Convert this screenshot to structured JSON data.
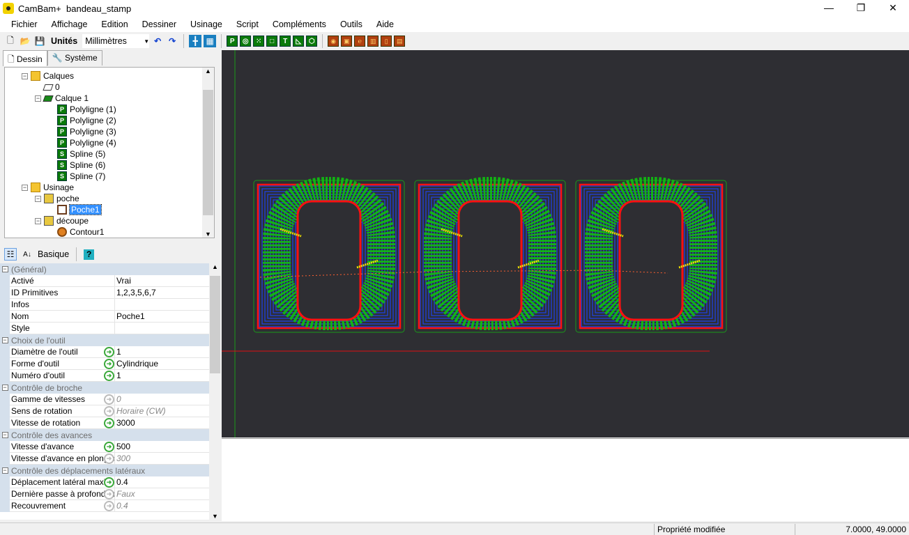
{
  "window": {
    "app": "CamBam+",
    "file": "bandeau_stamp",
    "minimize": "—",
    "maximize": "❐",
    "close": "✕"
  },
  "menu": [
    "Fichier",
    "Affichage",
    "Edition",
    "Dessiner",
    "Usinage",
    "Script",
    "Compléments",
    "Outils",
    "Aide"
  ],
  "toolbar": {
    "units_label": "Unités",
    "units_value": "Millimètres"
  },
  "tabs": [
    {
      "label": "Dessin",
      "icon": "page-icon"
    },
    {
      "label": "Système",
      "icon": "wrench-icon"
    }
  ],
  "tree": [
    {
      "label": "Calques",
      "depth": 0,
      "icon": "folder",
      "exp": "−"
    },
    {
      "label": "0",
      "depth": 1,
      "icon": "layer",
      "exp": ""
    },
    {
      "label": "Calque 1",
      "depth": 1,
      "icon": "layerg",
      "exp": "−"
    },
    {
      "label": "Polyligne (1)",
      "depth": 2,
      "icon": "poly",
      "exp": ""
    },
    {
      "label": "Polyligne (2)",
      "depth": 2,
      "icon": "poly",
      "exp": ""
    },
    {
      "label": "Polyligne (3)",
      "depth": 2,
      "icon": "poly",
      "exp": ""
    },
    {
      "label": "Polyligne (4)",
      "depth": 2,
      "icon": "poly",
      "exp": ""
    },
    {
      "label": "Spline (5)",
      "depth": 2,
      "icon": "spline",
      "exp": ""
    },
    {
      "label": "Spline (6)",
      "depth": 2,
      "icon": "spline",
      "exp": ""
    },
    {
      "label": "Spline (7)",
      "depth": 2,
      "icon": "spline",
      "exp": ""
    },
    {
      "label": "Usinage",
      "depth": 0,
      "icon": "folder",
      "exp": "−"
    },
    {
      "label": "poche",
      "depth": 1,
      "icon": "cube",
      "exp": "−"
    },
    {
      "label": "Poche1",
      "depth": 2,
      "icon": "pocket",
      "exp": "",
      "selected": true
    },
    {
      "label": "découpe",
      "depth": 1,
      "icon": "cube",
      "exp": "−"
    },
    {
      "label": "Contour1",
      "depth": 2,
      "icon": "contour",
      "exp": ""
    }
  ],
  "propbar": {
    "mode": "Basique",
    "help": "?"
  },
  "properties": [
    {
      "cat": "(Général)"
    },
    {
      "name": "Activé",
      "value": "Vrai"
    },
    {
      "name": "ID Primitives",
      "value": "1,2,3,5,6,7"
    },
    {
      "name": "Infos",
      "value": ""
    },
    {
      "name": "Nom",
      "value": "Poche1"
    },
    {
      "name": "Style",
      "value": ""
    },
    {
      "cat": "Choix de l'outil"
    },
    {
      "name": "Diamètre de l'outil",
      "value": "1",
      "arrow": "on"
    },
    {
      "name": "Forme d'outil",
      "value": "Cylindrique",
      "arrow": "on"
    },
    {
      "name": "Numéro d'outil",
      "value": "1",
      "arrow": "on"
    },
    {
      "cat": "Contrôle de broche"
    },
    {
      "name": "Gamme de vitesses",
      "value": "0",
      "arrow": "off"
    },
    {
      "name": "Sens de rotation",
      "value": "Horaire (CW)",
      "arrow": "off"
    },
    {
      "name": "Vitesse de rotation",
      "value": "3000",
      "arrow": "on"
    },
    {
      "cat": "Contrôle des avances"
    },
    {
      "name": "Vitesse d'avance",
      "value": "500",
      "arrow": "on"
    },
    {
      "name": "Vitesse d'avance en plongée",
      "value": "300",
      "arrow": "off"
    },
    {
      "cat": "Contrôle des déplacements latéraux"
    },
    {
      "name": "Déplacement latéral maxi",
      "value": "0.4",
      "arrow": "on"
    },
    {
      "name": "Dernière passe à profondeur",
      "value": "Faux",
      "arrow": "off"
    },
    {
      "name": "Recouvrement",
      "value": "0.4",
      "arrow": "off"
    }
  ],
  "status": {
    "message": "Propriété modifiée",
    "coords": "7.0000, 49.0000"
  },
  "colors": {
    "canvas": "#2e2e33",
    "toolpath_blue": "#2040e0",
    "toolpath_green": "#10c010",
    "outline_red": "#ff1010",
    "rapid_yellow": "#f0e000"
  }
}
